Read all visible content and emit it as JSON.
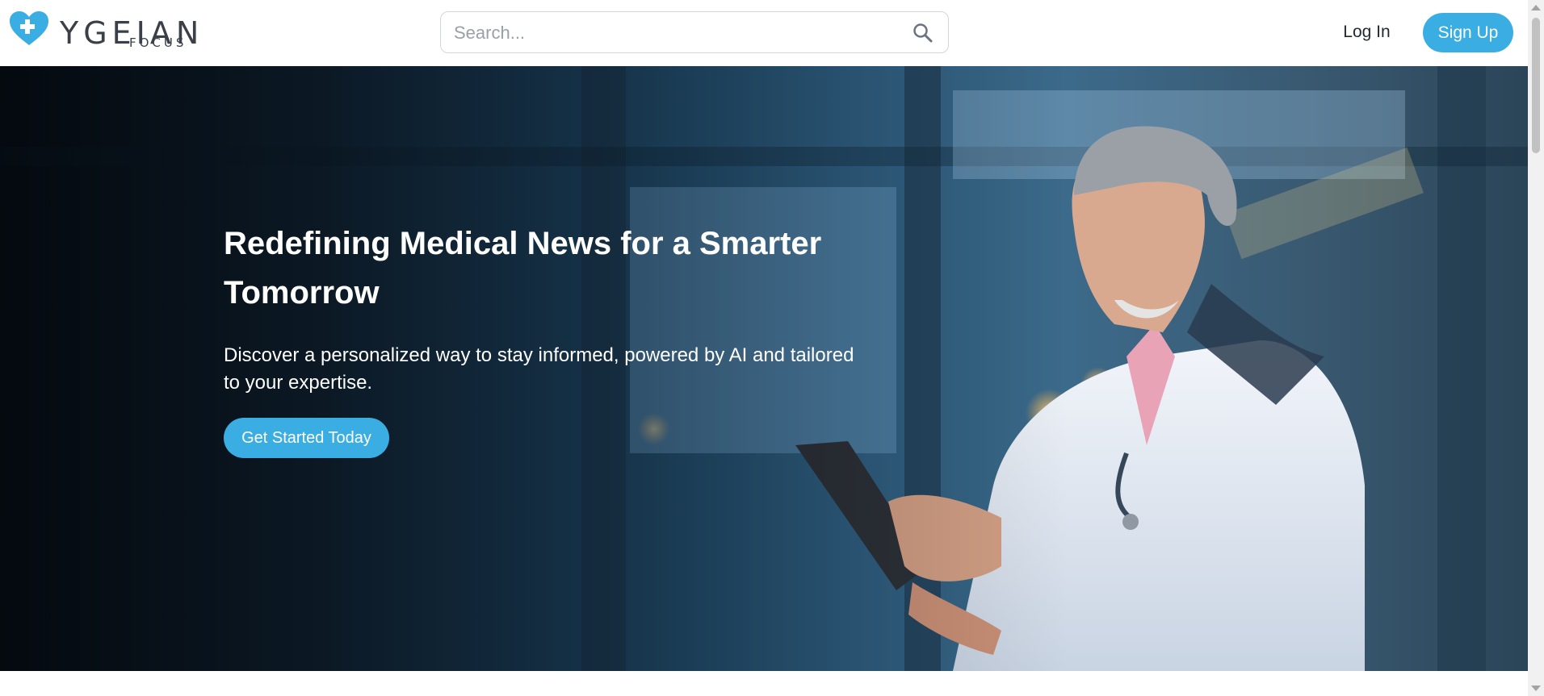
{
  "header": {
    "brand": "YGEIAN",
    "tagline": "FOCUS",
    "search_placeholder": "Search...",
    "login_label": "Log In",
    "signup_label": "Sign Up"
  },
  "hero": {
    "title": "Redefining Medical News for a Smarter Tomorrow",
    "subtitle": "Discover a personalized way to stay informed, powered by AI and tailored to your expertise.",
    "cta_label": "Get Started Today"
  },
  "icons": {
    "logo": "heart-cross-icon",
    "search": "search-icon"
  },
  "colors": {
    "accent": "#3aaee2",
    "brand_text": "#3a3f48"
  }
}
